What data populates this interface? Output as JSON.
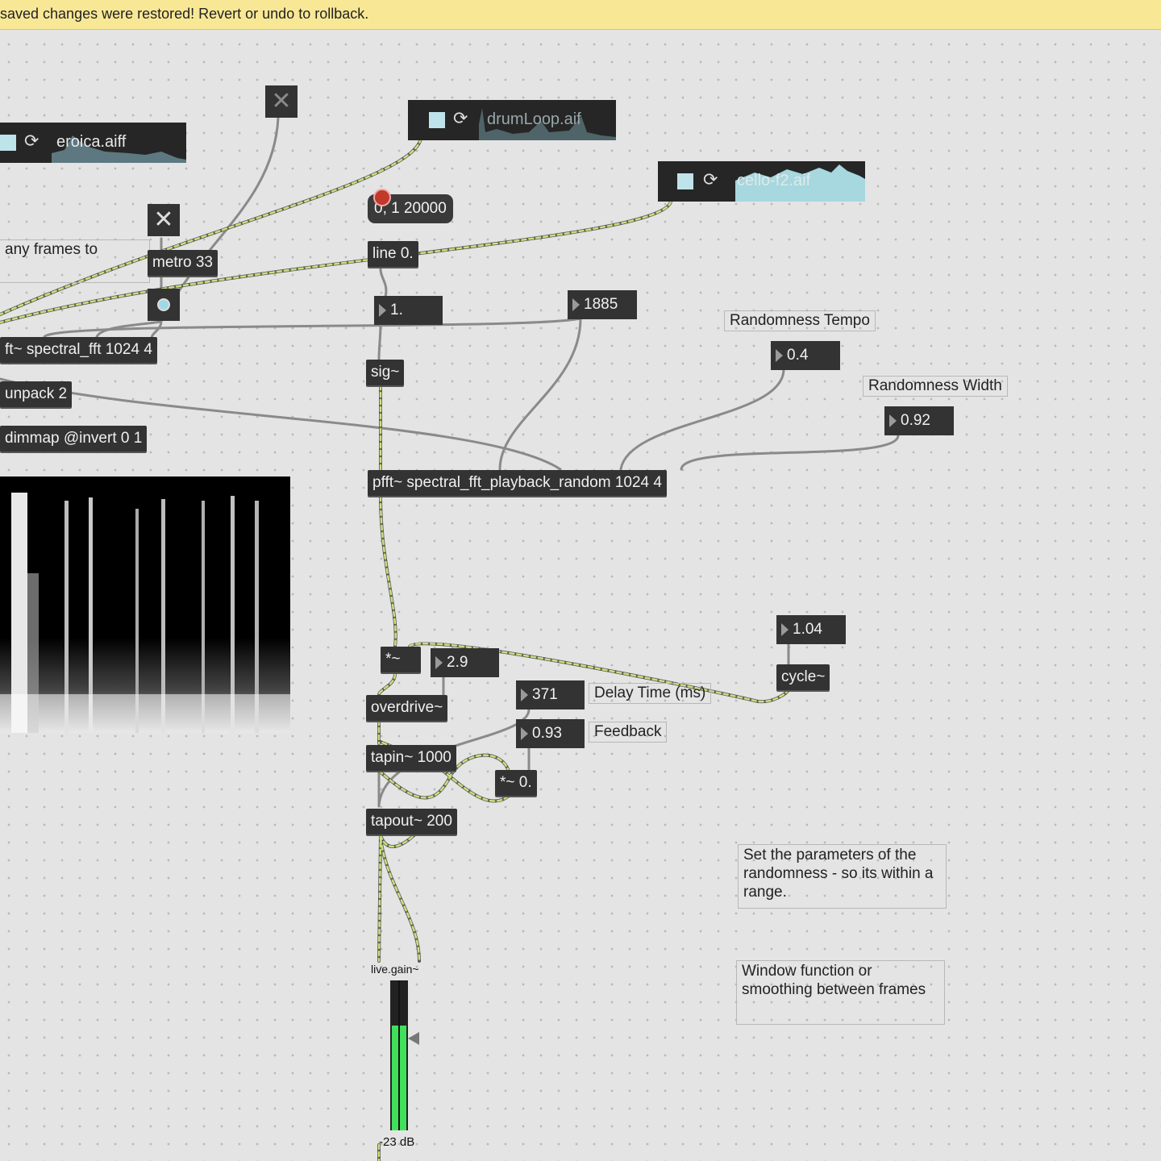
{
  "banner": {
    "text": "saved changes were restored! Revert or undo to rollback."
  },
  "players": {
    "eroica": {
      "filename": "eroica.aiff",
      "stop_icon": "stop-square-icon",
      "loop_icon": "loop-arrows-icon"
    },
    "drumloop": {
      "filename": "drumLoop.aif",
      "stop_icon": "stop-square-icon",
      "loop_icon": "loop-arrows-icon"
    },
    "cello": {
      "filename": "cello-f2.aif",
      "stop_icon": "stop-square-icon",
      "loop_icon": "loop-arrows-icon"
    }
  },
  "objects": {
    "message_line": "0, 1 20000",
    "line": "line 0.",
    "number_float": "1.",
    "sig": "sig~",
    "number_1885": "1885",
    "metro": "metro 33",
    "pfft_record": "ft~ spectral_fft 1024 4",
    "unpack": "unpack 2",
    "dimmap": "dimmap @invert 0 1",
    "pfft_playback": "pfft~ spectral_fft_playback_random 1024 4",
    "multiply": "*~",
    "overdrive_value": "2.9",
    "overdrive": "overdrive~",
    "tapin": "tapin~ 1000",
    "tapout": "tapout~ 200",
    "delay_value": "371",
    "feedback_value": "0.93",
    "multiply_feedback": "*~ 0.",
    "cycle_freq": "1.04",
    "cycle": "cycle~",
    "random_tempo_value": "0.4",
    "random_width_value": "0.92"
  },
  "comments": {
    "frames_to": "any frames to",
    "random_tempo": "Randomness Tempo",
    "random_width": "Randomness Width",
    "delay_time": "Delay Time (ms)",
    "feedback": "Feedback",
    "set_params": "Set the parameters of the randomness - so its within a range.",
    "window_function": "Window function or smoothing between frames"
  },
  "live_gain": {
    "title": "live.gain~",
    "value_label": "-23 dB",
    "level": 0.7
  },
  "colors": {
    "banner": "#f8e896",
    "canvas": "#e4e4e4",
    "object": "#333333",
    "meter": "#41e05b",
    "audio_patchcord": "#c9e07a"
  },
  "icons": {
    "toggle": "close-x-icon",
    "bang": "bang-circle-icon"
  }
}
